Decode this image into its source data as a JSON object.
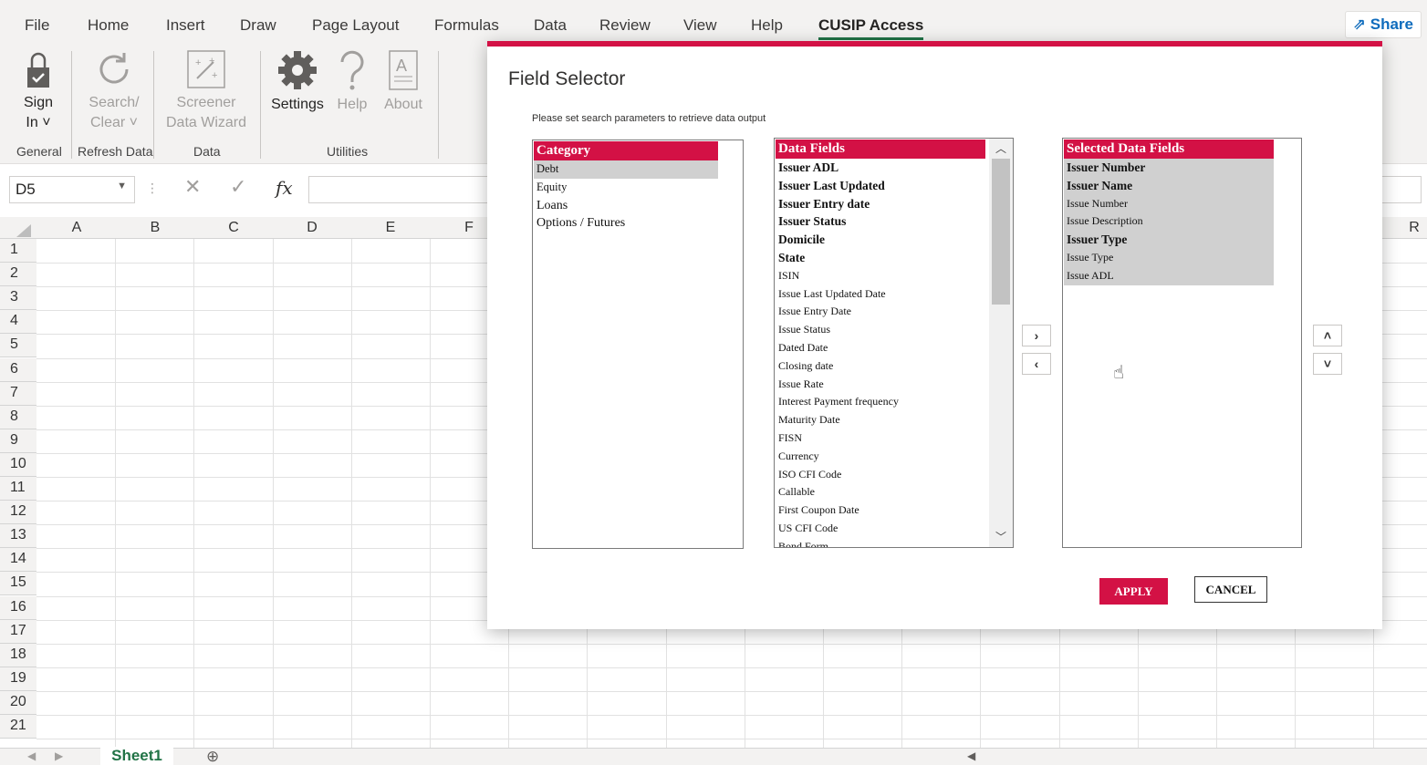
{
  "ribbon": {
    "tabs": [
      "File",
      "Home",
      "Insert",
      "Draw",
      "Page Layout",
      "Formulas",
      "Data",
      "Review",
      "View",
      "Help",
      "CUSIP Access"
    ],
    "active_tab": "CUSIP Access",
    "share_label": "Share",
    "buttons": {
      "sign_in": "Sign",
      "sign_in_2": "In ˅",
      "search": "Search/",
      "search_2": "Clear ˅",
      "screener": "Screener",
      "screener_2": "Data Wizard",
      "settings": "Settings",
      "help": "Help",
      "about": "About"
    },
    "groups": {
      "general": "General",
      "refresh": "Refresh Data",
      "data": "Data",
      "utilities": "Utilities"
    }
  },
  "formula_bar": {
    "name_box": "D5",
    "fx": "fx",
    "value": ""
  },
  "grid": {
    "columns_left": [
      "A",
      "B",
      "C",
      "D",
      "E",
      "F"
    ],
    "column_right": "R",
    "rows": [
      "1",
      "2",
      "3",
      "4",
      "5",
      "6",
      "7",
      "8",
      "9",
      "10",
      "11",
      "12",
      "13",
      "14",
      "15",
      "16",
      "17",
      "18",
      "19",
      "20",
      "21"
    ]
  },
  "sheets": {
    "active": "Sheet1",
    "add": "⊕"
  },
  "dialog": {
    "title": "Field Selector",
    "subtitle": "Please set search parameters to retrieve data output",
    "category": {
      "header": "Category",
      "items": [
        "Debt",
        "Equity",
        "Loans",
        "Options / Futures"
      ],
      "selected": "Debt"
    },
    "data_fields": {
      "header": "Data Fields",
      "items": [
        {
          "label": "Issuer ADL",
          "bold": true
        },
        {
          "label": "Issuer Last Updated",
          "bold": true
        },
        {
          "label": "Issuer Entry date",
          "bold": true
        },
        {
          "label": "Issuer Status",
          "bold": true
        },
        {
          "label": "Domicile",
          "bold": true
        },
        {
          "label": "State",
          "bold": true
        },
        {
          "label": "ISIN",
          "bold": false
        },
        {
          "label": "Issue Last Updated Date",
          "bold": false
        },
        {
          "label": "Issue Entry Date",
          "bold": false
        },
        {
          "label": "Issue Status",
          "bold": false
        },
        {
          "label": "Dated Date",
          "bold": false
        },
        {
          "label": "Closing date",
          "bold": false
        },
        {
          "label": "Issue Rate",
          "bold": false
        },
        {
          "label": "Interest Payment frequency",
          "bold": false
        },
        {
          "label": "Maturity Date",
          "bold": false
        },
        {
          "label": "FISN",
          "bold": false
        },
        {
          "label": "Currency",
          "bold": false
        },
        {
          "label": "ISO CFI Code",
          "bold": false
        },
        {
          "label": "Callable",
          "bold": false
        },
        {
          "label": "First Coupon Date",
          "bold": false
        },
        {
          "label": "US CFI Code",
          "bold": false
        },
        {
          "label": "Bond Form",
          "bold": false
        }
      ]
    },
    "selected_fields": {
      "header": "Selected Data Fields",
      "items": [
        {
          "label": "Issuer Number",
          "bold": true
        },
        {
          "label": "Issuer Name",
          "bold": true
        },
        {
          "label": "Issue Number",
          "bold": false
        },
        {
          "label": "Issue Description",
          "bold": false
        },
        {
          "label": "Issuer Type",
          "bold": true
        },
        {
          "label": "Issue Type",
          "bold": false
        },
        {
          "label": "Issue ADL",
          "bold": false
        }
      ]
    },
    "apply_label": "APPLY",
    "cancel_label": "CANCEL"
  },
  "colors": {
    "accent": "#d31145",
    "excel_green": "#217346",
    "selection_gray": "#d0d0d0"
  }
}
